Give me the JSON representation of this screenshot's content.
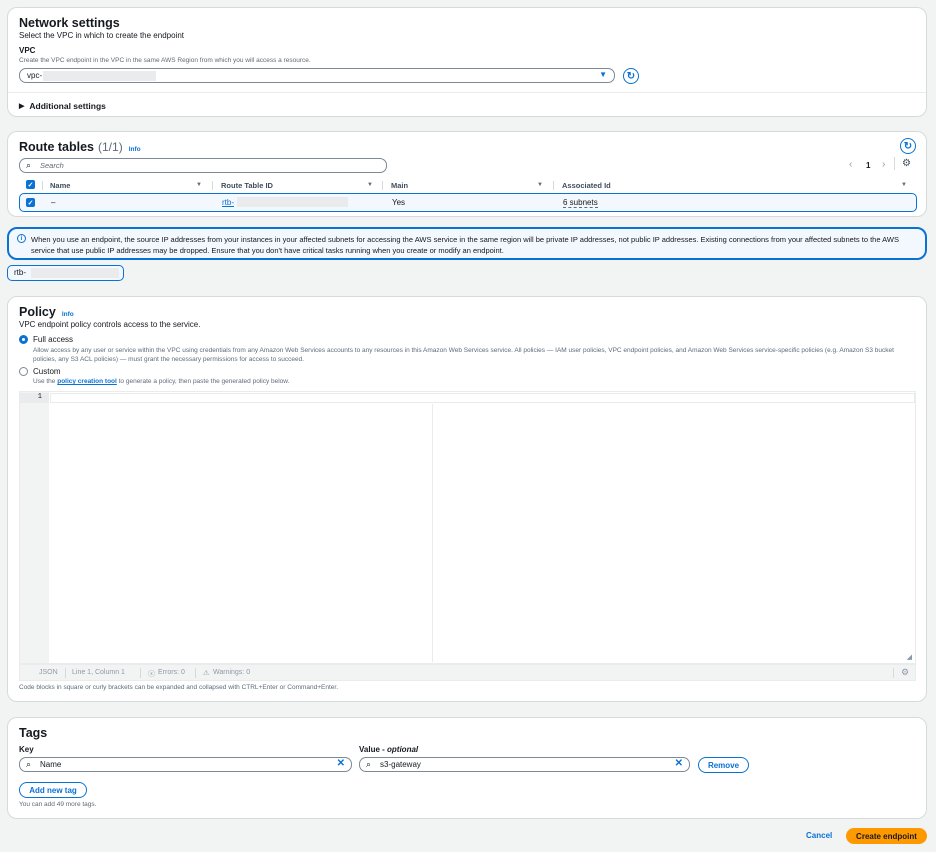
{
  "network": {
    "title": "Network settings",
    "description": "Select the VPC in which to create the endpoint",
    "vpc_label": "VPC",
    "vpc_sublabel": "Create the VPC endpoint in the VPC in the same AWS Region from which you will access a resource.",
    "vpc_value": "vpc-",
    "additional_settings": "Additional settings"
  },
  "route_tables": {
    "title": "Route tables",
    "count": "(1/1)",
    "info": "Info",
    "search_placeholder": "Search",
    "page": "1",
    "columns": [
      "Name",
      "Route Table ID",
      "Main",
      "Associated Id"
    ],
    "rows": [
      {
        "name": "–",
        "route_table_id": "rtb-",
        "main": "Yes",
        "associated_id": "6 subnets"
      }
    ]
  },
  "alert": {
    "text": "When you use an endpoint, the source IP addresses from your instances in your affected subnets for accessing the AWS service in the same region will be private IP addresses, not public IP addresses. Existing connections from your affected subnets to the AWS service that use public IP addresses may be dropped. Ensure that you don't have critical tasks running when you create or modify an endpoint."
  },
  "selected_token": "rtb-",
  "policy": {
    "title": "Policy",
    "info": "Info",
    "description": "VPC endpoint policy controls access to the service.",
    "full_access_label": "Full access",
    "full_access_desc": "Allow access by any user or service within the VPC using credentials from any Amazon Web Services accounts to any resources in this Amazon Web Services service. All policies — IAM user policies, VPC endpoint policies, and Amazon Web Services service-specific policies (e.g. Amazon S3 bucket policies, any S3 ACL policies) — must grant the necessary permissions for access to succeed.",
    "custom_label": "Custom",
    "custom_desc_prefix": "Use the",
    "custom_desc_link": "policy creation tool",
    "custom_desc_suffix": "to generate a policy, then paste the generated policy below.",
    "line_number": "1",
    "status_lang": "JSON",
    "status_position": "Line 1, Column 1",
    "status_errors": "Errors: 0",
    "status_warnings": "Warnings: 0",
    "footer_hint": "Code blocks in square or curly brackets can be expanded and collapsed with CTRL+Enter or Command+Enter."
  },
  "tags": {
    "title": "Tags",
    "key_label": "Key",
    "value_label": "Value - ",
    "value_label_opt": "optional",
    "key_value": "Name",
    "value_value": "s3-gateway",
    "remove": "Remove",
    "add_new": "Add new tag",
    "limit_hint": "You can add 49 more tags."
  },
  "footer": {
    "cancel": "Cancel",
    "create": "Create endpoint"
  },
  "colors": {
    "accent": "#0972d3",
    "primary_button": "#ff9900",
    "info_bg": "#f2f8fd"
  }
}
